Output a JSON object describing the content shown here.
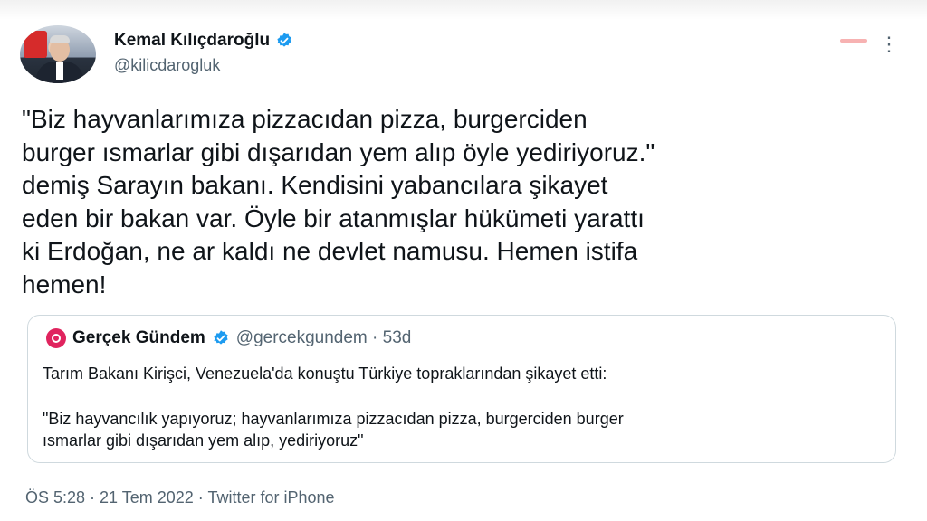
{
  "author": {
    "name": "Kemal Kılıçdaroğlu",
    "handle": "@kilicdarogluk"
  },
  "tweet": {
    "text": "\"Biz hayvanlarımıza pizzacıdan pizza, burgerciden\nburger ısmarlar gibi dışarıdan yem alıp öyle yediriyoruz.\"\ndemiş Sarayın bakanı. Kendisini yabancılara şikayet\neden bir bakan var. Öyle bir atanmışlar hükümeti yarattı\nki Erdoğan, ne ar kaldı ne devlet namusu. Hemen istifa\nhemen!"
  },
  "quote": {
    "name": "Gerçek Gündem",
    "handle_time": "@gercekgundem · 53d",
    "line1": "Tarım Bakanı Kirişci, Venezuela'da konuştu Türkiye topraklarından şikayet etti:",
    "line2": "\"Biz hayvancılık yapıyoruz; hayvanlarımıza pizzacıdan pizza, burgerciden burger\nısmarlar gibi dışarıdan yem alıp, yediriyoruz\""
  },
  "footer": {
    "meta": "ÖS 5:28 · 21 Tem 2022 · Twitter for iPhone"
  },
  "icons": {
    "verified": "verified-badge-icon",
    "more": "more-options-icon",
    "quote_logo": "gercek-gundem-logo-icon"
  },
  "colors": {
    "verified_blue": "#1d9bf0",
    "secondary_text": "#536471",
    "quote_logo": "#e0245e"
  }
}
